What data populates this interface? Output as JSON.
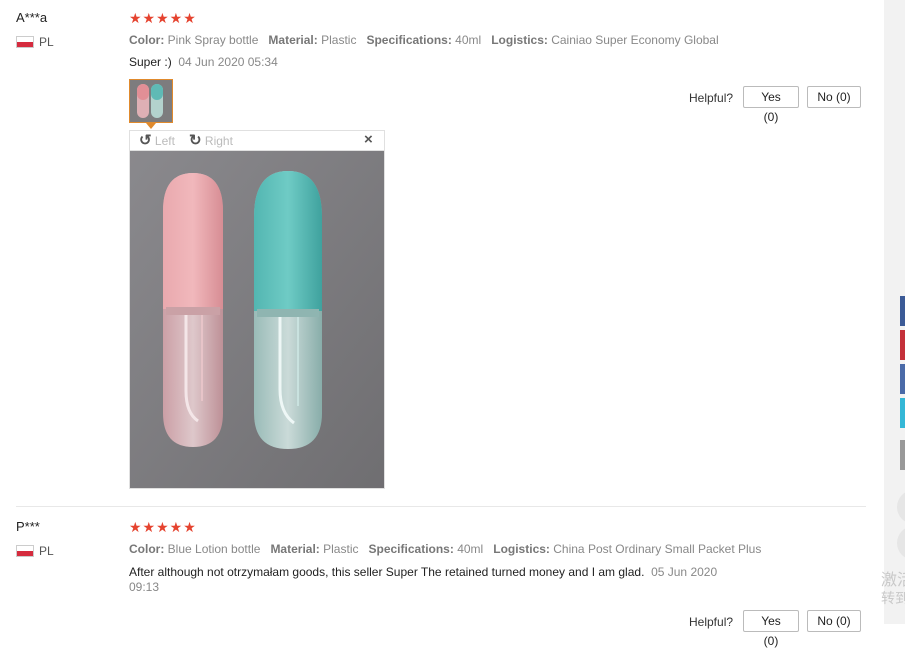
{
  "reviews": [
    {
      "user": "A***a",
      "country": "PL",
      "stars": "★★★★★",
      "attrs": [
        {
          "key": "Color:",
          "value": "Pink Spray bottle"
        },
        {
          "key": "Material:",
          "value": "Plastic"
        },
        {
          "key": "Specifications:",
          "value": "40ml"
        },
        {
          "key": "Logistics:",
          "value": "Cainiao Super Economy Global"
        }
      ],
      "text": "Super :)",
      "date": "04 Jun 2020 05:34",
      "helpful_label": "Helpful?",
      "yes_label": "Yes (0)",
      "no_label": "No (0)"
    },
    {
      "user": "P***",
      "country": "PL",
      "stars": "★★★★★",
      "attrs": [
        {
          "key": "Color:",
          "value": "Blue Lotion bottle"
        },
        {
          "key": "Material:",
          "value": "Plastic"
        },
        {
          "key": "Specifications:",
          "value": "40ml"
        },
        {
          "key": "Logistics:",
          "value": "China Post Ordinary Small Packet Plus"
        }
      ],
      "text": "After although not otrzymałam goods, this seller Super The retained turned money and I am glad.",
      "date_line1": "05 Jun 2020",
      "date_line2": "09:13",
      "helpful_label": "Helpful?",
      "yes_label": "Yes (0)",
      "no_label": "No (0)"
    }
  ],
  "image_viewer": {
    "rotate_left_label": "Left",
    "rotate_right_label": "Right",
    "close_label": "×"
  },
  "side": {
    "cjk_line1": "激活",
    "cjk_line2": "转到"
  },
  "colors": {
    "star": "#e5432f",
    "thumb_border": "#e08a2d",
    "flag_red": "#d52b3e"
  }
}
